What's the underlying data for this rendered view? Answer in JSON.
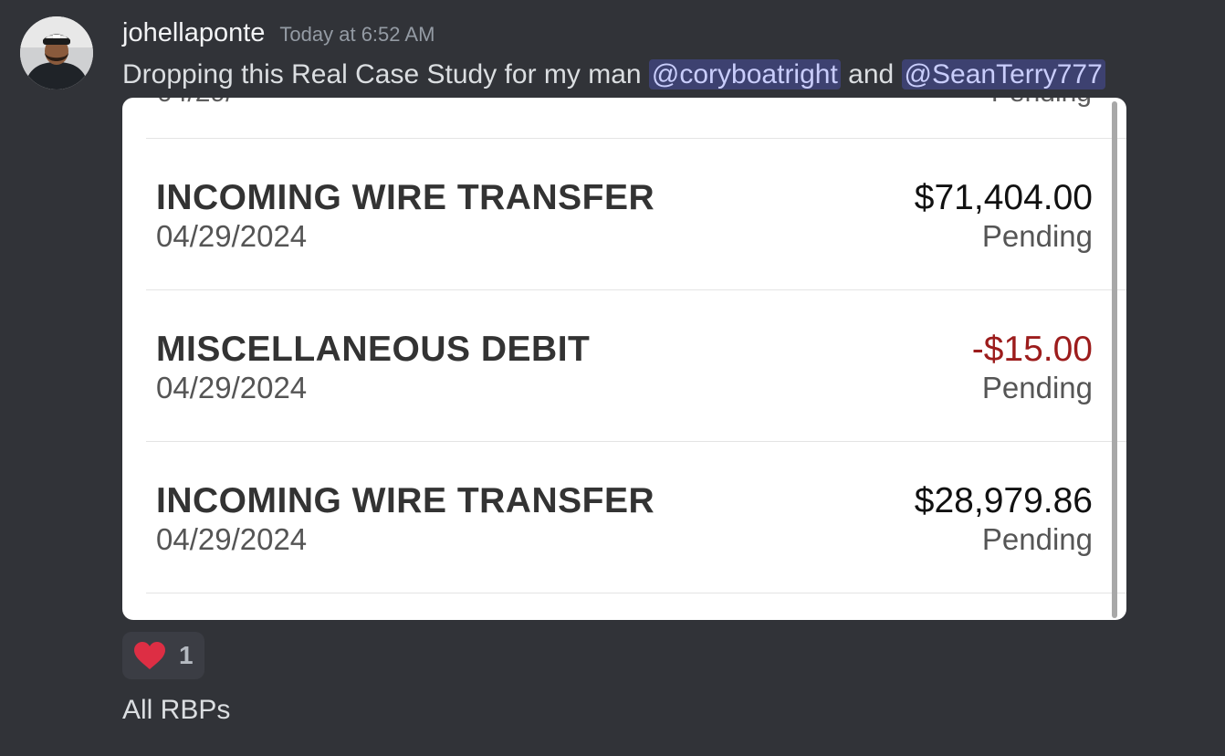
{
  "message": {
    "author": "johellaponte",
    "timestamp": "Today at 6:52 AM",
    "text_before": "Dropping this Real Case Study for my man ",
    "mention_1": "@coryboatright",
    "text_between": " and ",
    "mention_2": "@SeanTerry777",
    "avatar_icon": "user-avatar-photo"
  },
  "attachment": {
    "transactions": [
      {
        "title": "INCOMING WIRE TRANSFER",
        "date": "04/29/2024",
        "amount": "$71,404.00",
        "status": "Pending"
      },
      {
        "title": "MISCELLANEOUS DEBIT",
        "date": "04/29/2024",
        "amount": "-$15.00",
        "status": "Pending"
      },
      {
        "title": "INCOMING WIRE TRANSFER",
        "date": "04/29/2024",
        "amount": "$28,979.86",
        "status": "Pending"
      }
    ]
  },
  "reaction": {
    "emoji_icon": "red-heart-icon",
    "count": "1"
  },
  "followup": {
    "text": "All RBPs"
  },
  "colors": {
    "background": "#313338",
    "mention_bg": "#3c4270",
    "mention_text": "#c9cdfb",
    "negative_amount": "#9c1c1c"
  }
}
